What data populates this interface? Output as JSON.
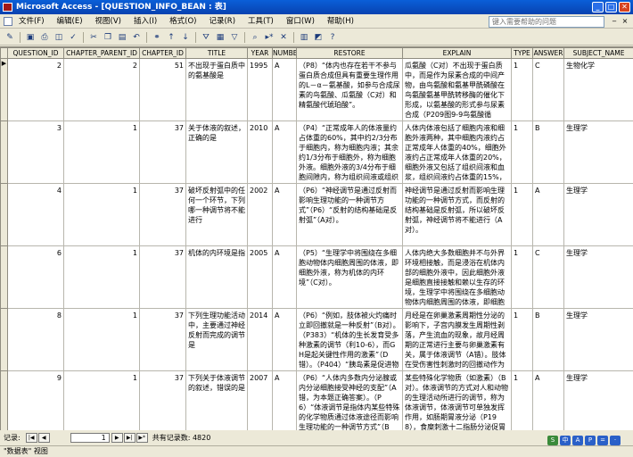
{
  "window": {
    "title": "Microsoft Access - [QUESTION_INFO_BEAN : 表]"
  },
  "menu": {
    "items": [
      "文件(F)",
      "编辑(E)",
      "视图(V)",
      "插入(I)",
      "格式(O)",
      "记录(R)",
      "工具(T)",
      "窗口(W)",
      "帮助(H)"
    ],
    "help_placeholder": "键入需要帮助的问题"
  },
  "toolbar": {
    "icons": [
      "design-view-icon",
      "save-icon",
      "print-icon",
      "print-preview-icon",
      "spelling-icon",
      "cut-icon",
      "copy-icon",
      "paste-icon",
      "undo-icon",
      "insert-hyperlink-icon",
      "sort-ascending-icon",
      "sort-descending-icon",
      "filter-by-selection-icon",
      "filter-by-form-icon",
      "apply-filter-icon",
      "find-icon",
      "new-record-icon",
      "delete-record-icon",
      "database-window-icon",
      "new-object-icon",
      "help-icon"
    ]
  },
  "table": {
    "columns": [
      "QUESTION_ID",
      "CHAPTER_PARENT_ID",
      "CHAPTER_ID",
      "TITLE",
      "YEAR",
      "NUMBER",
      "RESTORE",
      "EXPLAIN",
      "TYPE",
      "ANSWER",
      "SUBJECT_NAME"
    ],
    "rows": [
      {
        "marker": "▶",
        "cells": [
          "2",
          "2",
          "51",
          "不出现于蛋白质中的氨基酸是",
          "1995",
          "A",
          "（P8）“体内也存在若干不参与蛋白质合成但具有重要生理作用的L－α－氨基酸，如参与合成尿素的鸟氨酸、瓜氨酸（C对）和精氨酸代琥珀酸”。",
          "瓜氨酸（C对）不出现于蛋白质中，而是作为尿素合成的中间产物，由鸟氨酸和氨基甲酰磷酸在鸟氨酸氨基甲酰转移酶的催化下形成，以氨基酸的形式参与尿素合成（P209图9-9鸟氨酸循环）。注：不出现于蛋白质中的",
          "1",
          "C",
          "生物化学"
        ]
      },
      {
        "marker": "",
        "cells": [
          "3",
          "1",
          "37",
          "关于体液的叙述，正确的是",
          "2010",
          "A",
          "（P4）“正常成年人的体液量约占体重的60%，其中约2/3分布于细胞内，称为细胞内液；其余约1/3分布于细胞外，称为细胞外液。细胞外液的3/4分布于细胞间隙内，称为组织间液或组织液；其余约1/4则在血管中不",
          "人体内体液包括了细胞内液和细胞外液两种，其中细胞内液约占正常成年人体重的40%，细胞外液约占正常成年人体重的20%，细胞外液又包括了组织间液和血浆，组织间液约占体重的15%，血浆约占体重的5%，故分布在人",
          "1",
          "B",
          "生理学"
        ]
      },
      {
        "marker": "",
        "cells": [
          "4",
          "1",
          "37",
          "破坏反射弧中的任何一个环节，下列哪一种调节将不能进行",
          "2002",
          "A",
          "（P6）“神经调节是通过反射而影响生理功能的一种调节方式”（P6）“反射的结构基础是反射弧”（A对）。",
          "神经调节是通过反射而影响生理功能的一种调节方式，而反射的结构基础是反射弧，所以破坏反射弧，神经调节将不能进行（A对）。",
          "1",
          "A",
          "生理学"
        ]
      },
      {
        "marker": "",
        "cells": [
          "6",
          "1",
          "37",
          "机体的内环境是指",
          "2005",
          "A",
          "（P5）“生理学中将围绕在多细胞动物体内细胞周围的体液，即细胞外液，称为机体的内环境”（C对）。",
          "人体内绝大多数细胞并不与外界环境相接触，而是浸浴在机体内部的细胞外液中，因此细胞外液是细胞直接接触和赖以生存的环境，生理学中将围绕在多细胞动物体内细胞周围的体液，即细胞外液，称为内环境（C对），以",
          "1",
          "C",
          "生理学"
        ]
      },
      {
        "marker": "",
        "cells": [
          "8",
          "1",
          "37",
          "下列生理功能活动中，主要通过神经反射而完成的调节是",
          "2014",
          "A",
          "（P6）“例如，肢体被火灼痛时立即回撤就是一种反射”（B对）。（P383）“机体的生长发育受多种激素的调节（利10-6），而GH是起关键性作用的激素”（D错）。（P404）“胰岛素是促进物质合成代谢，维持血",
          "月经是在卵巢激素周期性分泌的影响下，子宫内膜发生周期性剥落，产生流血的现象，故月经周期的正常进行主要与卵巢激素有关，属于体液调节（A错）。肢体在受伤害性刺激时的回撤动作为痛觉感受器介导的非条件反",
          "1",
          "B",
          "生理学"
        ]
      },
      {
        "marker": "",
        "cells": [
          "9",
          "1",
          "37",
          "下列关于体液调节的叙述，错误的是",
          "2007",
          "A",
          "（P6）“人体内多数内分泌腺或内分泌细胞接受神经的支配”（A错，为本题正确答案）。（P6）“体液调节是指体内某些特殊的化学物质通过体液途径而影响生理功能的一种调节方式”（B对）。（P6）“有些细胞产",
          "某些特殊化学物质（如激素）（B对）。体液调节的方式对人和动物的生理活动所进行的调节，称为体液调节，体液调节可单独发挥作用，如肠期胃液分泌（P198），食糜刺激十二指肠分泌促胃液素，进而促进胃酸分",
          "1",
          "A",
          "生理学"
        ]
      }
    ]
  },
  "status": {
    "record_label": "记录:",
    "record_number": "1",
    "total_text": "共有记录数: 4820",
    "view_text": "\"数据表\" 视图"
  },
  "ime": [
    "S",
    "中",
    "A",
    "P",
    "=",
    "·"
  ],
  "colors": {
    "titlebar": "#0a5fd8",
    "window_bg": "#ece9d8"
  }
}
